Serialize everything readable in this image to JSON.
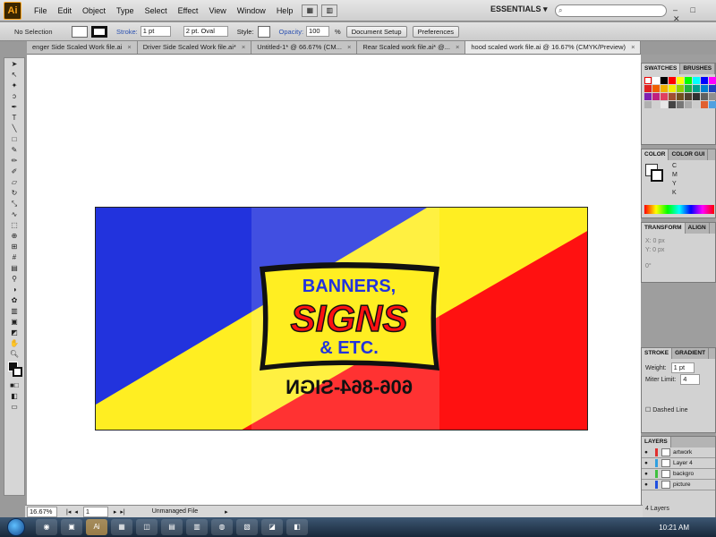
{
  "app": {
    "logo": "Ai"
  },
  "menu": [
    "File",
    "Edit",
    "Object",
    "Type",
    "Select",
    "Effect",
    "View",
    "Window",
    "Help"
  ],
  "workspace": {
    "label": "ESSENTIALS ▾",
    "search_placeholder": ""
  },
  "window_controls": "– □ ✕",
  "control_bar": {
    "selection": "No Selection",
    "stroke_label": "Stroke:",
    "stroke_value": "1 pt",
    "brush": "2 pt. Oval",
    "style_label": "Style:",
    "opacity_label": "Opacity:",
    "opacity_value": "100",
    "opacity_unit": "%",
    "doc_setup": "Document Setup",
    "preferences": "Preferences"
  },
  "tabs": [
    {
      "label": "enger Side Scaled Work file.ai"
    },
    {
      "label": "Driver Side Scaled Work file.ai*"
    },
    {
      "label": "Untitled-1* @ 66.67% (CM..."
    },
    {
      "label": "Rear Scaled work file.ai* @..."
    },
    {
      "label": "hood scaled work file.ai @ 16.67% (CMYK/Preview)",
      "active": true
    }
  ],
  "artwork": {
    "line1": "BANNERS,",
    "line2": "SIGNS",
    "line3": "& ETC.",
    "phone": "606-864-SIGN",
    "colors": {
      "blue": "#2233dd",
      "yellow": "#ffee22",
      "red": "#ff1111",
      "black": "#111111"
    }
  },
  "panels": {
    "swatches": {
      "tab1": "SWATCHES",
      "tab2": "BRUSHES"
    },
    "color": {
      "tab1": "COLOR",
      "tab2": "COLOR GUI",
      "rows": [
        "C",
        "M",
        "Y",
        "K"
      ]
    },
    "transform": {
      "tab1": "TRANSFORM",
      "tab2": "ALIGN",
      "x": "X: 0 px",
      "y": "Y: 0 px",
      "angle": "0°"
    },
    "stroke": {
      "tab1": "STROKE",
      "tab2": "GRADIENT",
      "weight_label": "Weight:",
      "weight_value": "1 pt",
      "miter_label": "Miter Limit:",
      "miter_value": "4",
      "dashed": "Dashed Line"
    },
    "layers": {
      "tab": "LAYERS",
      "items": [
        {
          "name": "artwork",
          "color": "#e03030"
        },
        {
          "name": "Layer 4",
          "color": "#30a0e0"
        },
        {
          "name": "backgro",
          "color": "#40c040"
        },
        {
          "name": "picture",
          "color": "#2050e0"
        }
      ],
      "count": "4 Layers"
    }
  },
  "status": {
    "zoom": "16.67%",
    "page": "1",
    "file": "Unmanaged File"
  },
  "taskbar": {
    "clock": "10:21 AM"
  }
}
